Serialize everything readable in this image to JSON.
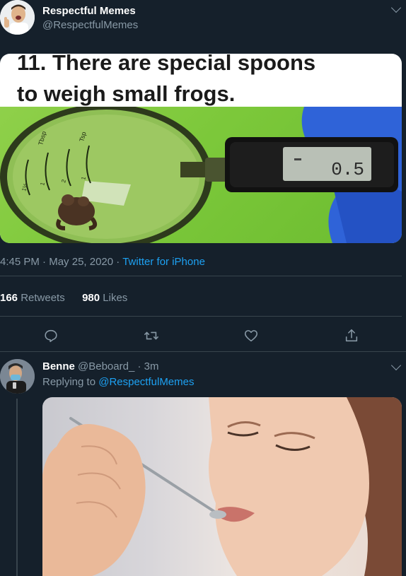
{
  "tweet": {
    "display_name": "Respectful Memes",
    "handle": "@RespectfulMemes",
    "image_caption_line1": "11. There are special spoons",
    "image_caption_line2": "to weigh small frogs.",
    "scale_display": "0.5",
    "spoon_labels": [
      "Tbsp",
      "Tsp",
      "1½",
      "1",
      "2",
      "1"
    ],
    "time": "4:45 PM",
    "date": "May 25, 2020",
    "separator": " · ",
    "source": "Twitter for iPhone",
    "retweets_count": "166",
    "retweets_label": " Retweets",
    "likes_count": "980",
    "likes_label": " Likes"
  },
  "actions": [
    "reply-icon",
    "retweet-icon",
    "like-icon",
    "share-icon"
  ],
  "reply_tweet": {
    "display_name": "Benne",
    "handle": "@Beboard_",
    "time_ago": " · 3m",
    "replying_prefix": "Replying to ",
    "replying_to": "@RespectfulMemes"
  },
  "colors": {
    "background": "#15202b",
    "secondary_text": "#8899a6",
    "accent": "#1da1f2",
    "divider": "#38444d"
  }
}
